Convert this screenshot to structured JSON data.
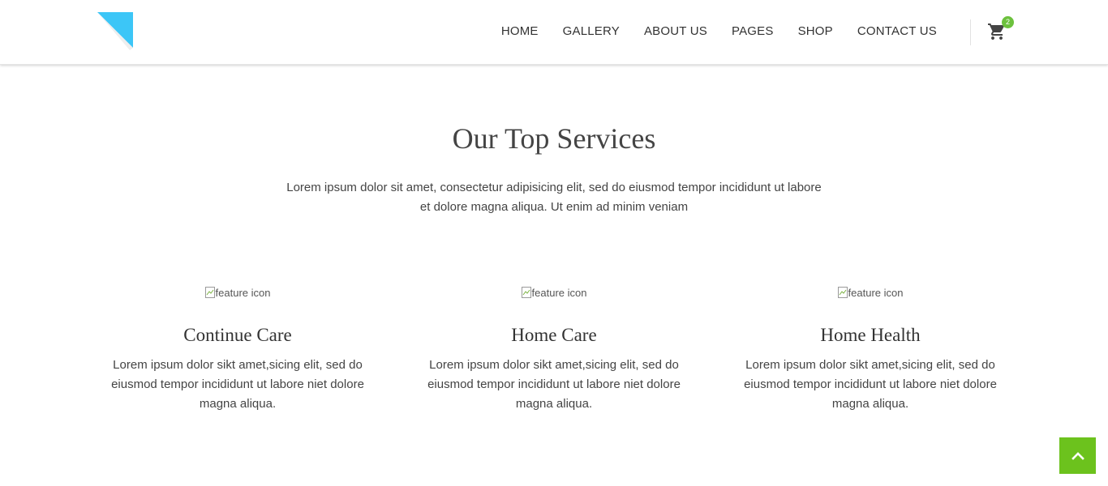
{
  "colors": {
    "logo_accent": "#3cc6f7",
    "badge": "#6cc13d",
    "back_to_top": "#6cc21d"
  },
  "header": {
    "logo_icon": "corner-fold-logo",
    "nav": [
      {
        "label": "HOME"
      },
      {
        "label": "GALLERY"
      },
      {
        "label": "ABOUT US"
      },
      {
        "label": "PAGES"
      },
      {
        "label": "SHOP"
      },
      {
        "label": "CONTACT US"
      }
    ],
    "cart": {
      "icon": "cart-icon",
      "count": "2"
    }
  },
  "services": {
    "title": "Our Top Services",
    "intro": "Lorem ipsum dolor sit amet, consectetur adipisicing elit, sed do eiusmod tempor incididunt ut labore et dolore magna aliqua. Ut enim ad minim veniam",
    "items": [
      {
        "img_alt": "feature icon",
        "title": "Continue Care",
        "text": "Lorem ipsum dolor sikt amet,sicing elit, sed do eiusmod tempor incididunt ut labore niet dolore magna aliqua."
      },
      {
        "img_alt": "feature icon",
        "title": "Home Care",
        "text": "Lorem ipsum dolor sikt amet,sicing elit, sed do eiusmod tempor incididunt ut labore niet dolore magna aliqua."
      },
      {
        "img_alt": "feature icon",
        "title": "Home Health",
        "text": "Lorem ipsum dolor sikt amet,sicing elit, sed do eiusmod tempor incididunt ut labore niet dolore magna aliqua."
      }
    ]
  },
  "back_to_top": {
    "icon": "chevron-up-icon"
  }
}
